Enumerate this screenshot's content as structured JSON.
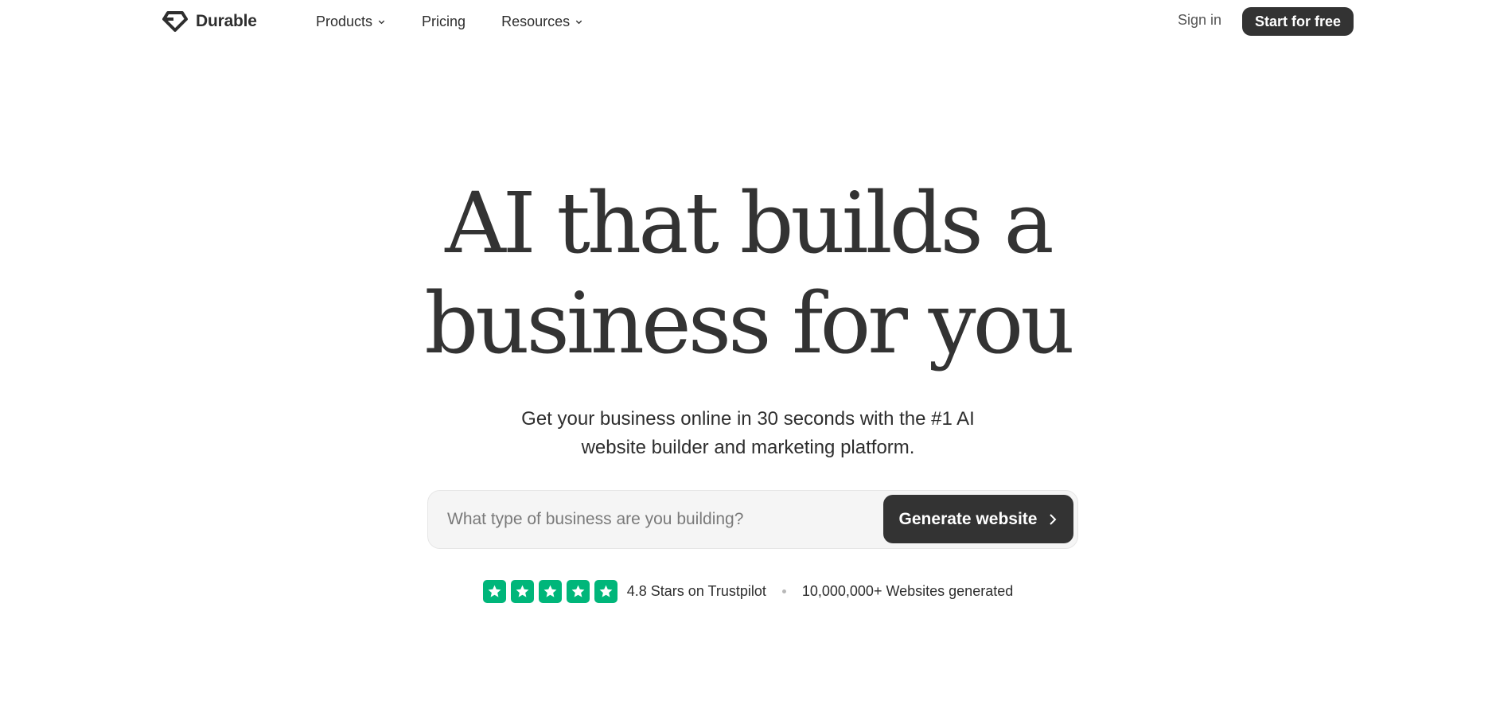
{
  "brand": {
    "name": "Durable",
    "logo_icon": "diamond-logo-icon"
  },
  "nav": {
    "items": [
      {
        "label": "Products",
        "has_dropdown": true
      },
      {
        "label": "Pricing",
        "has_dropdown": false
      },
      {
        "label": "Resources",
        "has_dropdown": true
      }
    ],
    "signin_label": "Sign in",
    "cta_label": "Start for free"
  },
  "hero": {
    "title_line1": "AI that builds a",
    "title_line2": "business for you",
    "subtitle_line1": "Get your business online in 30 seconds with the #1 AI",
    "subtitle_line2": "website builder and marketing platform."
  },
  "search": {
    "placeholder": "What type of business are you building?",
    "value": "",
    "button_label": "Generate website"
  },
  "trust": {
    "rating_text": "4.8 Stars on Trustpilot",
    "stars": 5,
    "websites_text": "10,000,000+ Websites generated",
    "star_color": "#00b67a"
  },
  "colors": {
    "primary_dark": "#333333",
    "text": "#2e2e2e",
    "input_bg": "#f5f5f5"
  }
}
